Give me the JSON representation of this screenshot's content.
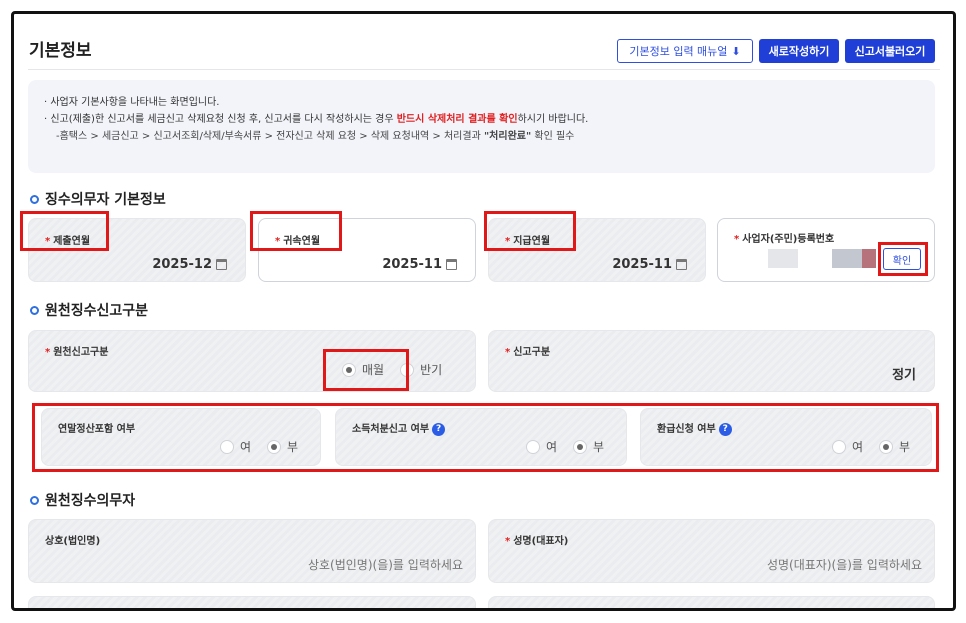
{
  "header": {
    "title": "기본정보",
    "manual_button": "기본정보 입력 매뉴얼",
    "new_button": "새로작성하기",
    "load_button": "신고서불러오기"
  },
  "notice": {
    "line1": "· 사업자 기본사항을 나타내는 화면입니다.",
    "line2_pre": "· 신고(제출)한 신고서를 세금신고 삭제요청 신청 후, 신고서를 다시 작성하시는 경우 ",
    "line2_red": "반드시 삭제처리 결과를 확인",
    "line2_post": "하시기 바랍니다.",
    "line3_pre": "-홈택스 > 세금신고 > 신고서조회/삭제/부속서류 > 전자신고 삭제 요청 > 삭제 요청내역 > 처리결과 ",
    "line3_bold": "\"처리완료\"",
    "line3_post": " 확인 필수"
  },
  "sections": {
    "withholder_info": "징수의무자 기본정보",
    "filing_type": "원천징수신고구분",
    "withholder": "원천징수의무자"
  },
  "withholder_info": {
    "submit_label": "제출연월",
    "submit_value": "2025-12",
    "belong_label": "귀속연월",
    "belong_value": "2025-11",
    "pay_label": "지급연월",
    "pay_value": "2025-11",
    "reg_label": "사업자(주민)등록번호",
    "confirm_button": "확인"
  },
  "filing_type": {
    "withholding_label": "원천신고구분",
    "option_monthly": "매월",
    "option_half": "반기",
    "selected": "매월",
    "report_label": "신고구분",
    "report_value": "정기"
  },
  "options": {
    "year_end_label": "연말정산포함 여부",
    "income_disposal_label": "소득처분신고 여부",
    "refund_label": "환급신청 여부",
    "yes": "여",
    "no": "부",
    "help_icon_text": "?"
  },
  "withholder": {
    "company_label": "상호(법인명)",
    "company_placeholder": "상호(법인명)(을)를 입력하세요",
    "rep_label": "성명(대표자)",
    "rep_placeholder": "성명(대표자)(을)를 입력하세요"
  },
  "colors": {
    "accent": "#1f3fd6",
    "required": "#e02020",
    "highlight_box": "#e01818"
  }
}
